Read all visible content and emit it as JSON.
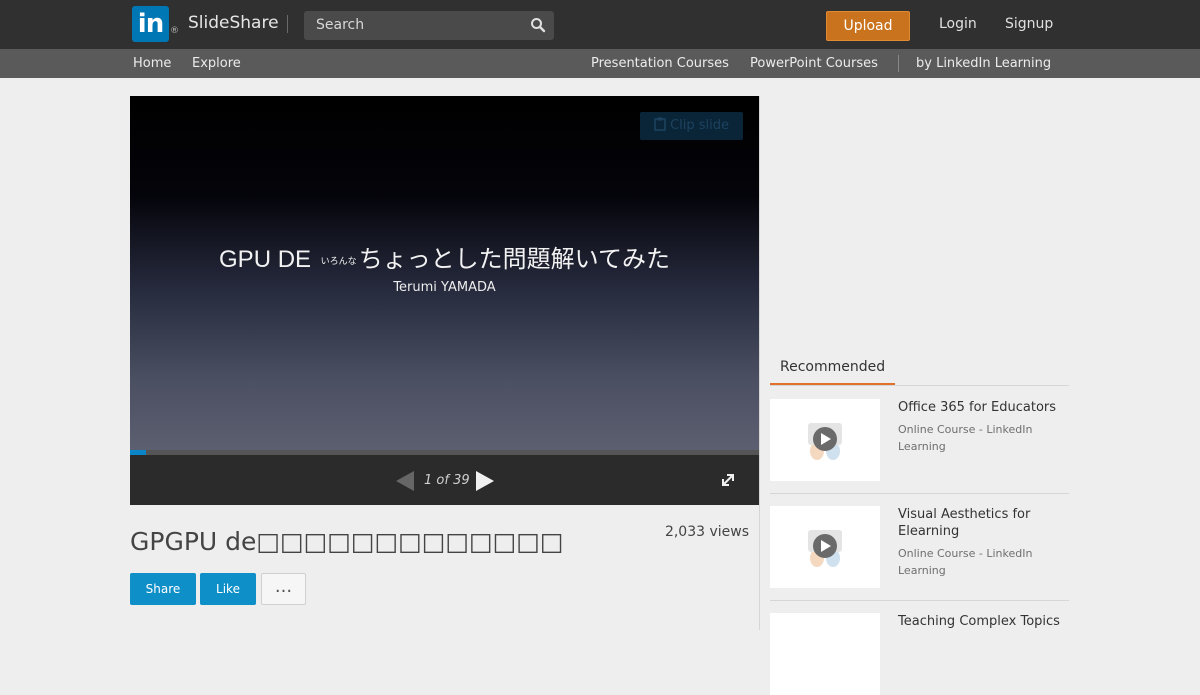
{
  "header": {
    "logo_text": "in",
    "logo_reg": "®",
    "brand": "SlideShare",
    "search_placeholder": "Search",
    "upload_label": "Upload",
    "login_label": "Login",
    "signup_label": "Signup"
  },
  "subnav": {
    "left": [
      "Home",
      "Explore"
    ],
    "right": [
      "Presentation Courses",
      "PowerPoint Courses",
      "by LinkedIn Learning"
    ]
  },
  "slide": {
    "title_prefix": "GPU DE",
    "title_ruby": "いろんな",
    "title_main": "ちょっとした問題解いてみた",
    "author": "Terumi YAMADA",
    "clip_label": "Clip slide"
  },
  "player": {
    "page_counter": "1 of 39",
    "progress": 0.026
  },
  "presentation": {
    "title": "GPGPU de□□□□□□□□□□□□□",
    "views": "2,033 views",
    "share_label": "Share",
    "like_label": "Like",
    "more_label": "..."
  },
  "recommended": {
    "tab_label": "Recommended",
    "items": [
      {
        "title": "Office 365 for Educators",
        "subtitle": "Online Course - LinkedIn Learning"
      },
      {
        "title": "Visual Aesthetics for Elearning",
        "subtitle": "Online Course - LinkedIn Learning"
      },
      {
        "title": "Teaching Complex Topics",
        "subtitle": ""
      }
    ]
  },
  "colors": {
    "brand_blue": "#0077b5",
    "upload_orange": "#c9731e",
    "action_blue": "#0e8fc8",
    "tab_accent": "#e26f2a"
  },
  "icons": [
    "linkedin-logo-icon",
    "search-icon",
    "clipboard-icon",
    "prev-arrow-icon",
    "next-arrow-icon",
    "fullscreen-icon",
    "play-icon"
  ]
}
